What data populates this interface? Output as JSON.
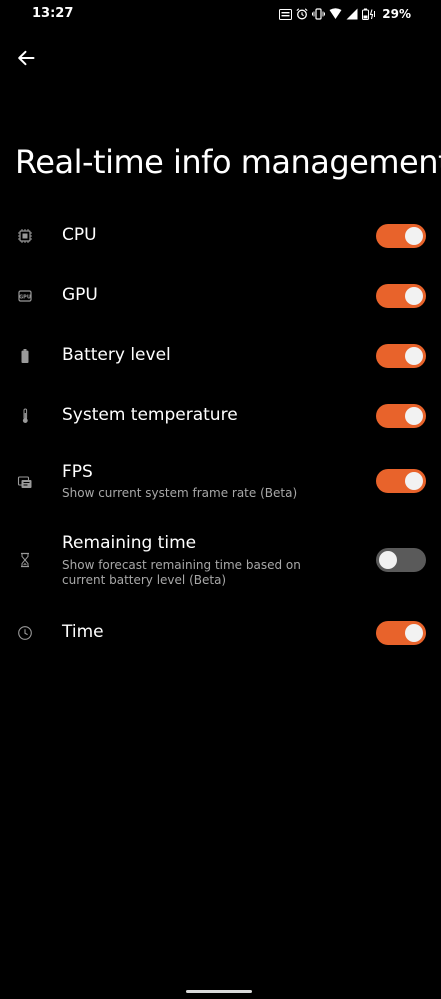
{
  "status_bar": {
    "time": "13:27",
    "battery_percent": "29%",
    "icons": [
      "hdr-icon",
      "alarm-icon",
      "vibrate-icon",
      "wifi-icon",
      "signal-icon",
      "battery-icon"
    ]
  },
  "header": {
    "back_icon": "arrow-left-icon",
    "title": "Real-time info management"
  },
  "accent_color": "#e8632b",
  "settings": [
    {
      "icon": "cpu-icon",
      "title": "CPU",
      "subtitle": "",
      "enabled": true
    },
    {
      "icon": "gpu-icon",
      "title": "GPU",
      "subtitle": "",
      "enabled": true
    },
    {
      "icon": "battery-icon",
      "title": "Battery level",
      "subtitle": "",
      "enabled": true
    },
    {
      "icon": "thermometer-icon",
      "title": "System temperature",
      "subtitle": "",
      "enabled": true
    },
    {
      "icon": "fps-icon",
      "title": "FPS",
      "subtitle": "Show current system frame rate (Beta)",
      "enabled": true
    },
    {
      "icon": "hourglass-icon",
      "title": "Remaining time",
      "subtitle": "Show forecast remaining time based on current battery level (Beta)",
      "enabled": false
    },
    {
      "icon": "clock-icon",
      "title": "Time",
      "subtitle": "",
      "enabled": true
    }
  ]
}
